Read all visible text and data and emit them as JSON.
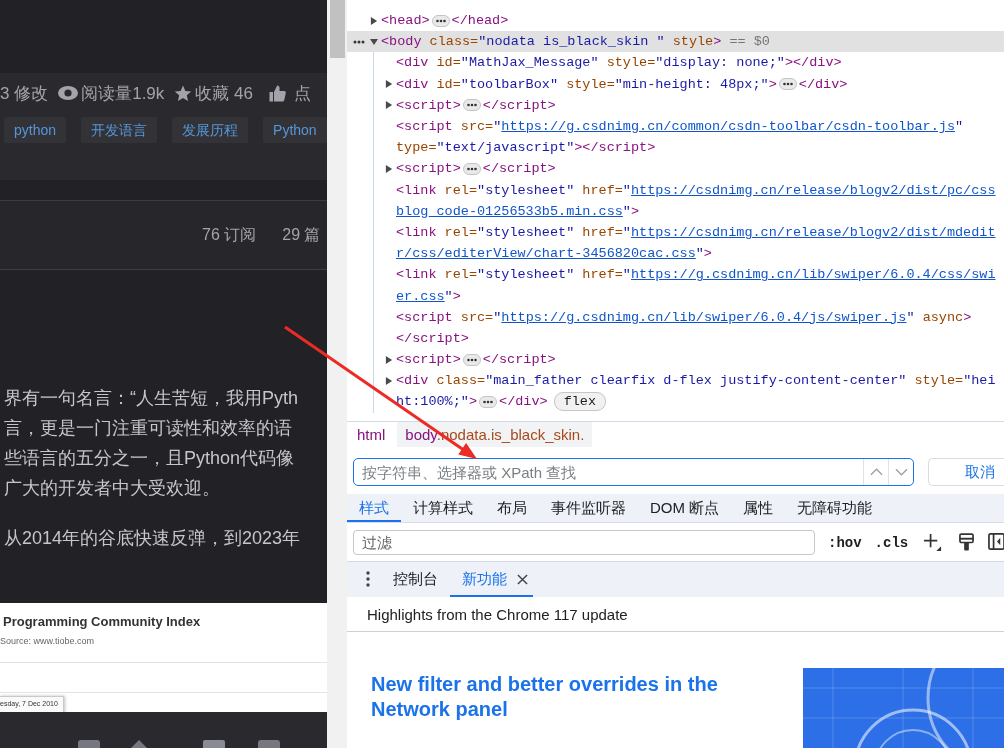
{
  "article": {
    "meta": [
      {
        "kind": "edits",
        "text": "3 修改"
      },
      {
        "kind": "views",
        "text": "阅读量1.9k"
      },
      {
        "kind": "favorites",
        "text": "收藏 46"
      },
      {
        "kind": "likes",
        "text": "点"
      }
    ],
    "tags": [
      "python",
      "开发语言",
      "发展历程",
      "Python"
    ],
    "column_stats": [
      "76 订阅",
      "29 篇"
    ],
    "paragraphs": [
      [
        "界有一句名言：“人生苦短，我用Pyth",
        "言，更是一门注重可读性和效率的语",
        "些语言的五分之一，且Python代码像",
        "广大的开发者中大受欢迎。"
      ],
      [
        "从2014年的谷底快速反弹，到2023年"
      ]
    ],
    "figure": {
      "title": "Programming Community Index",
      "source": "Source: www.tiobe.com",
      "tooltip": "esday, 7 Dec 2010"
    }
  },
  "devtools": {
    "dom_tree": [
      {
        "kind": "container",
        "expanded": false,
        "selected": false,
        "lines": [
          [
            {
              "kind": "tag",
              "text": "<head>"
            },
            {
              "kind": "ellipsis"
            },
            {
              "kind": "tag",
              "text": "</head>"
            }
          ]
        ]
      },
      {
        "kind": "container",
        "expanded": true,
        "selected": true,
        "lines": [
          [
            {
              "kind": "tag",
              "text": "<body"
            },
            {
              "kind": "attr",
              "text": " class="
            },
            {
              "kind": "value",
              "text": "\"nodata is_black_skin \""
            },
            {
              "kind": "attr",
              "text": " style"
            },
            {
              "kind": "tag",
              "text": ">"
            },
            {
              "kind": "hint",
              "text": " == $0"
            }
          ]
        ],
        "children": [
          {
            "kind": "leaf",
            "selected": false,
            "lines": [
              [
                {
                  "kind": "tag",
                  "text": "<div"
                },
                {
                  "kind": "attr",
                  "text": " id="
                },
                {
                  "kind": "value",
                  "text": "\"MathJax_Message\""
                },
                {
                  "kind": "attr",
                  "text": " style="
                },
                {
                  "kind": "value",
                  "text": "\"display: none;\""
                },
                {
                  "kind": "tag",
                  "text": "></div>"
                }
              ]
            ]
          },
          {
            "kind": "container",
            "expanded": false,
            "selected": false,
            "lines": [
              [
                {
                  "kind": "tag",
                  "text": "<div"
                },
                {
                  "kind": "attr",
                  "text": " id="
                },
                {
                  "kind": "value",
                  "text": "\"toolbarBox\""
                },
                {
                  "kind": "attr",
                  "text": " style="
                },
                {
                  "kind": "value",
                  "text": "\"min-height: 48px;\""
                },
                {
                  "kind": "tag",
                  "text": ">"
                },
                {
                  "kind": "ellipsis"
                },
                {
                  "kind": "tag",
                  "text": "</div>"
                }
              ]
            ]
          },
          {
            "kind": "container",
            "expanded": false,
            "selected": false,
            "lines": [
              [
                {
                  "kind": "tag",
                  "text": "<script>"
                },
                {
                  "kind": "ellipsis"
                },
                {
                  "kind": "tag",
                  "text": "</script>"
                }
              ]
            ]
          },
          {
            "kind": "leaf",
            "selected": false,
            "lines": [
              [
                {
                  "kind": "tag",
                  "text": "<script"
                },
                {
                  "kind": "attr",
                  "text": " src="
                },
                {
                  "kind": "value",
                  "text": "\""
                },
                {
                  "kind": "link",
                  "text": "https://g.csdnimg.cn/common/csdn-toolbar/csdn-toolbar.js"
                },
                {
                  "kind": "value",
                  "text": "\""
                }
              ],
              [
                {
                  "kind": "attr",
                  "text": "type="
                },
                {
                  "kind": "value",
                  "text": "\"text/javascript\""
                },
                {
                  "kind": "tag",
                  "text": "></script>"
                }
              ]
            ]
          },
          {
            "kind": "container",
            "expanded": false,
            "selected": false,
            "lines": [
              [
                {
                  "kind": "tag",
                  "text": "<script>"
                },
                {
                  "kind": "ellipsis"
                },
                {
                  "kind": "tag",
                  "text": "</script>"
                }
              ]
            ]
          },
          {
            "kind": "leaf",
            "selected": false,
            "lines": [
              [
                {
                  "kind": "tag",
                  "text": "<link"
                },
                {
                  "kind": "attr",
                  "text": " rel="
                },
                {
                  "kind": "value",
                  "text": "\"stylesheet\""
                },
                {
                  "kind": "attr",
                  "text": " href="
                },
                {
                  "kind": "value",
                  "text": "\""
                },
                {
                  "kind": "link",
                  "text": "https://csdnimg.cn/release/blogv2/dist/pc/css"
                }
              ],
              [
                {
                  "kind": "link",
                  "text": "blog_code-01256533b5.min.css"
                },
                {
                  "kind": "value",
                  "text": "\""
                },
                {
                  "kind": "tag",
                  "text": ">"
                }
              ]
            ]
          },
          {
            "kind": "leaf",
            "selected": false,
            "lines": [
              [
                {
                  "kind": "tag",
                  "text": "<link"
                },
                {
                  "kind": "attr",
                  "text": " rel="
                },
                {
                  "kind": "value",
                  "text": "\"stylesheet\""
                },
                {
                  "kind": "attr",
                  "text": " href="
                },
                {
                  "kind": "value",
                  "text": "\""
                },
                {
                  "kind": "link",
                  "text": "https://csdnimg.cn/release/blogv2/dist/mdedit"
                }
              ],
              [
                {
                  "kind": "link",
                  "text": "r/css/editerView/chart-3456820cac.css"
                },
                {
                  "kind": "value",
                  "text": "\""
                },
                {
                  "kind": "tag",
                  "text": ">"
                }
              ]
            ]
          },
          {
            "kind": "leaf",
            "selected": false,
            "lines": [
              [
                {
                  "kind": "tag",
                  "text": "<link"
                },
                {
                  "kind": "attr",
                  "text": " rel="
                },
                {
                  "kind": "value",
                  "text": "\"stylesheet\""
                },
                {
                  "kind": "attr",
                  "text": " href="
                },
                {
                  "kind": "value",
                  "text": "\""
                },
                {
                  "kind": "link",
                  "text": "https://g.csdnimg.cn/lib/swiper/6.0.4/css/swi"
                }
              ],
              [
                {
                  "kind": "link",
                  "text": "er.css"
                },
                {
                  "kind": "value",
                  "text": "\""
                },
                {
                  "kind": "tag",
                  "text": ">"
                }
              ]
            ]
          },
          {
            "kind": "leaf",
            "selected": false,
            "lines": [
              [
                {
                  "kind": "tag",
                  "text": "<script"
                },
                {
                  "kind": "attr",
                  "text": " src="
                },
                {
                  "kind": "value",
                  "text": "\""
                },
                {
                  "kind": "link",
                  "text": "https://g.csdnimg.cn/lib/swiper/6.0.4/js/swiper.js"
                },
                {
                  "kind": "value",
                  "text": "\""
                },
                {
                  "kind": "attr",
                  "text": " async"
                },
                {
                  "kind": "tag",
                  "text": ">"
                }
              ],
              [
                {
                  "kind": "tag",
                  "text": "</script>"
                }
              ]
            ]
          },
          {
            "kind": "container",
            "expanded": false,
            "selected": false,
            "lines": [
              [
                {
                  "kind": "tag",
                  "text": "<script>"
                },
                {
                  "kind": "ellipsis"
                },
                {
                  "kind": "tag",
                  "text": "</script>"
                }
              ]
            ]
          },
          {
            "kind": "container",
            "expanded": false,
            "selected": false,
            "lines": [
              [
                {
                  "kind": "tag",
                  "text": "<div"
                },
                {
                  "kind": "attr",
                  "text": " class="
                },
                {
                  "kind": "value",
                  "text": "\"main_father clearfix d-flex justify-content-center\""
                },
                {
                  "kind": "attr",
                  "text": " style="
                },
                {
                  "kind": "value",
                  "text": "\"hei"
                }
              ],
              [
                {
                  "kind": "value",
                  "text": "ht:100%;\""
                },
                {
                  "kind": "tag",
                  "text": ">"
                },
                {
                  "kind": "ellipsis"
                },
                {
                  "kind": "tag",
                  "text": "</div>"
                },
                {
                  "kind": "badge",
                  "text": "flex"
                }
              ]
            ]
          }
        ]
      }
    ],
    "breadcrumbs": [
      {
        "tag": "html",
        "selected": false
      },
      {
        "tag": "body",
        "classes": ".nodata.is_black_skin.",
        "selected": true
      }
    ],
    "search": {
      "placeholder": "按字符串、选择器或 XPath 查找",
      "cancel_label": "取消"
    },
    "tabs": [
      {
        "label": "样式",
        "selected": true
      },
      {
        "label": "计算样式",
        "selected": false
      },
      {
        "label": "布局",
        "selected": false
      },
      {
        "label": "事件监听器",
        "selected": false
      },
      {
        "label": "DOM 断点",
        "selected": false
      },
      {
        "label": "属性",
        "selected": false
      },
      {
        "label": "无障碍功能",
        "selected": false
      }
    ],
    "filter": {
      "placeholder": "过滤",
      "toggles": [
        ":hov",
        ".cls"
      ]
    },
    "drawer": {
      "tabs": [
        {
          "label": "控制台",
          "selected": false,
          "closable": false
        },
        {
          "label": "新功能",
          "selected": true,
          "closable": true
        }
      ],
      "banner": "Highlights from the Chrome 117 update",
      "headline": "New filter and better overrides in the Network panel"
    }
  }
}
